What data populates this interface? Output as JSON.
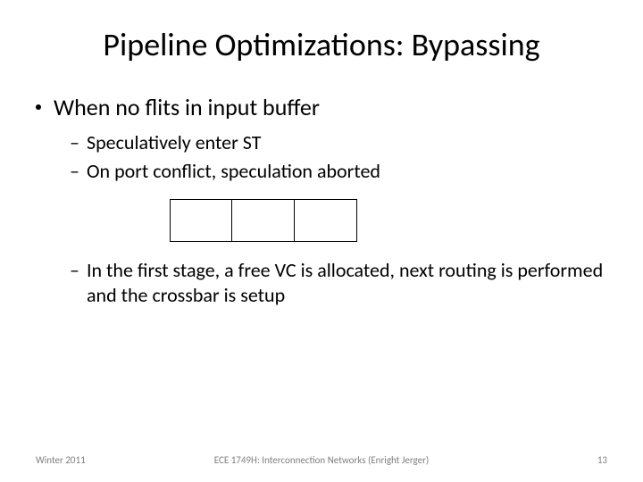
{
  "title": "Pipeline Optimizations: Bypassing",
  "bullets": {
    "l1": "When no flits in input buffer",
    "l2a": "Speculatively enter ST",
    "l2b": "On port conflict, speculation aborted",
    "l2c": "In the first stage, a free VC is allocated, next routing is performed and the crossbar is setup"
  },
  "footer": {
    "left": "Winter 2011",
    "center": "ECE 1749H: Interconnection Networks (Enright Jerger)",
    "right": "13"
  }
}
